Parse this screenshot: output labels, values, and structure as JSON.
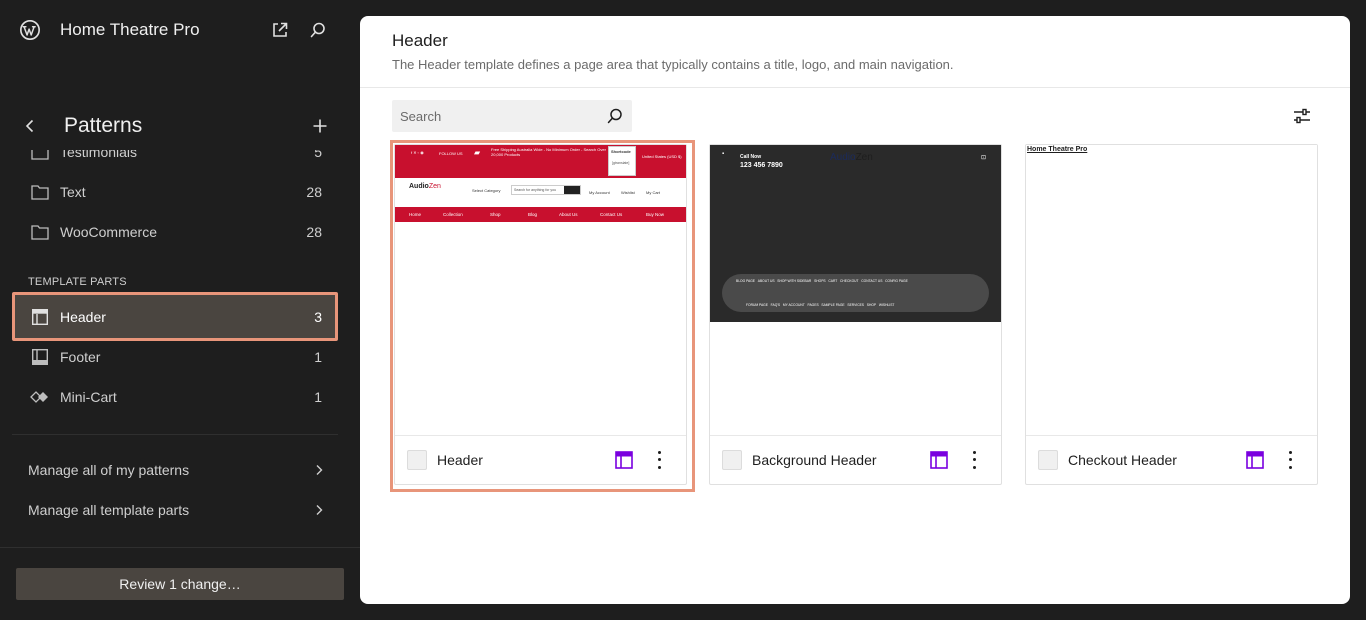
{
  "site": {
    "title": "Home Theatre Pro"
  },
  "sidebar": {
    "title": "Patterns",
    "items_top": [
      {
        "label": "Testimonials",
        "count": "5"
      },
      {
        "label": "Text",
        "count": "28"
      },
      {
        "label": "WooCommerce",
        "count": "28"
      }
    ],
    "section_label": "TEMPLATE PARTS",
    "template_parts": [
      {
        "label": "Header",
        "count": "3",
        "active": true
      },
      {
        "label": "Footer",
        "count": "1"
      },
      {
        "label": "Mini-Cart",
        "count": "1"
      }
    ],
    "manage_patterns": "Manage all of my patterns",
    "manage_parts": "Manage all template parts",
    "review_button": "Review 1 change…"
  },
  "main": {
    "title": "Header",
    "description": "The Header template defines a page area that typically contains a title, logo, and main navigation.",
    "search": {
      "placeholder": "Search",
      "value": ""
    },
    "cards": [
      {
        "name": "Header",
        "selected": true
      },
      {
        "name": "Background Header"
      },
      {
        "name": "Checkout Header"
      }
    ]
  },
  "previews": {
    "header": {
      "follow": "FOLLOW US",
      "shipping_line1": "Free Shipping Australia Wide - No Minimum Order - Search Over",
      "shipping_line2": "20,000 Products",
      "shortcode": "Shortcode",
      "shortcode_body": "[gtranslate]",
      "store_label": "United States (USD $)",
      "logo_a": "Audio",
      "logo_b": "Zen",
      "select_category": "Select Category",
      "search_placeholder": "Search for anything for you",
      "my_account": "My Account",
      "wishlist": "Wishlist",
      "my_cart": "My Cart",
      "nav": [
        "Home",
        "Collection",
        "Shop",
        "Blog",
        "About Us",
        "Contact Us",
        "Buy Now"
      ]
    },
    "background_header": {
      "call_now": "Call Now",
      "phone": "123 456 7890",
      "brand_a": "Audio",
      "brand_b": "Zen",
      "nav_row1": [
        "BLOG PAGE",
        "ABOUT US",
        "SHOP WITH SIDEBAR",
        "SHOPS",
        "CART",
        "CHECKOUT",
        "CONTACT US",
        "CONFIG PAGE"
      ],
      "nav_row2": [
        "FORUM PAGE",
        "FAQ'S",
        "MY ACCOUNT",
        "PAGES",
        "SAMPLE PAGE",
        "SERVICES",
        "SHOP",
        "WISHLIST"
      ]
    },
    "checkout_header": {
      "title": "Home Theatre Pro"
    }
  },
  "colors": {
    "accent_highlight": "#e8957a",
    "template_part_icon": "#7a00df",
    "preview_red": "#c8102e"
  }
}
